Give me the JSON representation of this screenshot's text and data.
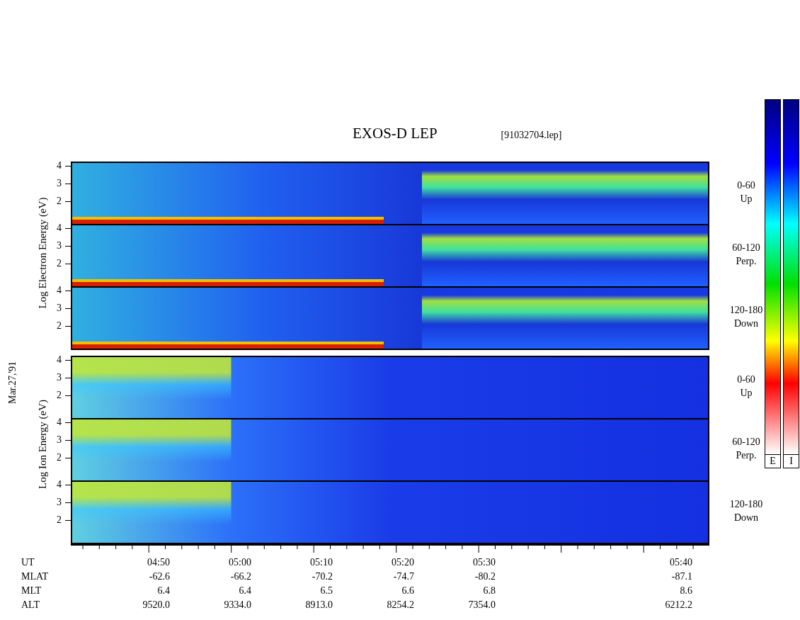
{
  "title": "EXOS-D LEP",
  "file": "[91032704.lep]",
  "date": "Mar.27,'91",
  "groups": [
    {
      "kind": "electron",
      "label": "Log  Electron  Energy (eV)",
      "panels": [
        {
          "ticks": [
            "4",
            "3",
            "2"
          ],
          "range": "0-60",
          "direction": "Up"
        },
        {
          "ticks": [
            "4",
            "3",
            "2"
          ],
          "range": "60-120",
          "direction": "Perp."
        },
        {
          "ticks": [
            "4",
            "3",
            "2"
          ],
          "range": "120-180",
          "direction": "Down"
        }
      ]
    },
    {
      "kind": "ion",
      "label": "Log  Ion  Energy (eV)",
      "panels": [
        {
          "ticks": [
            "4",
            "3",
            "2"
          ],
          "range": "0-60",
          "direction": "Up"
        },
        {
          "ticks": [
            "4",
            "3",
            "2"
          ],
          "range": "60-120",
          "direction": "Perp."
        },
        {
          "ticks": [
            "4",
            "3",
            "2"
          ],
          "range": "120-180",
          "direction": "Down"
        }
      ]
    }
  ],
  "colorbars": [
    {
      "label": "E"
    },
    {
      "label": "I"
    }
  ],
  "rows": [
    {
      "label": "UT",
      "values": [
        "04:50",
        "05:00",
        "05:10",
        "05:20",
        "05:30",
        "05:40"
      ]
    },
    {
      "label": "MLAT",
      "values": [
        "-62.6",
        "-66.2",
        "-70.2",
        "-74.7",
        "-80.2",
        "-87.1"
      ]
    },
    {
      "label": "MLT",
      "values": [
        "6.4",
        "6.4",
        "6.5",
        "6.6",
        "6.8",
        "8.6"
      ]
    },
    {
      "label": "ALT",
      "values": [
        "9520.0",
        "9334.0",
        "8913.0",
        "8254.2",
        "7354.0",
        "6212.2"
      ]
    }
  ]
}
